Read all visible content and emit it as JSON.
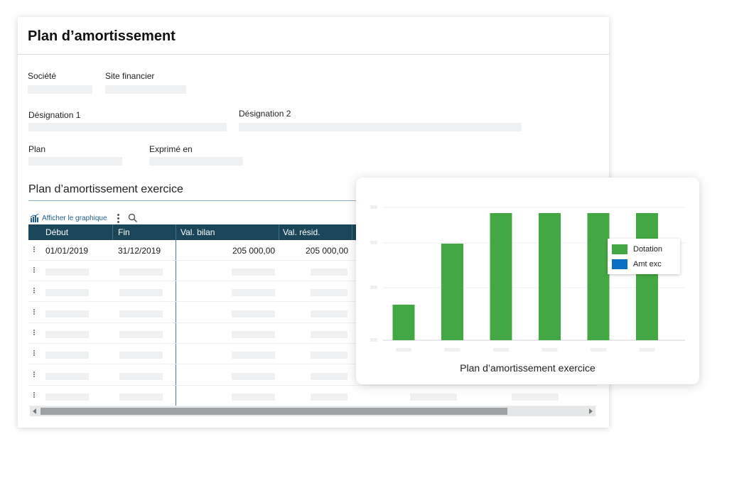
{
  "page": {
    "title": "Plan d’amortissement"
  },
  "fields": {
    "societe": "Société",
    "site_financier": "Site financier",
    "designation1": "Désignation 1",
    "designation2": "Désignation 2",
    "plan": "Plan",
    "exprime_en": "Exprimé en"
  },
  "section": {
    "title": "Plan d’amortissement exercice"
  },
  "toolbar": {
    "show_chart": "Afficher le graphique",
    "show_chart_icon": "chart-icon",
    "more_icon": "kebab-icon",
    "search_icon": "search-icon"
  },
  "table": {
    "headers": [
      "Début",
      "Fin",
      "Val. bilan",
      "Val. résid."
    ],
    "rows": [
      {
        "debut": "01/01/2019",
        "fin": "31/12/2019",
        "val_bilan": "205 000,00",
        "val_resid": "205 000,00"
      }
    ],
    "placeholder_rows": 7
  },
  "colors": {
    "header_bg": "#1b4659",
    "dotation": "#43a843",
    "amt_exc": "#0b6fc4",
    "placeholder": "#eef0f1"
  },
  "chart_data": {
    "type": "bar",
    "title": "Plan d’amortissement exercice",
    "categories": [
      "",
      "",
      "",
      "",
      "",
      ""
    ],
    "ylim": [
      0,
      100
    ],
    "grid": true,
    "legend_position": "right",
    "series": [
      {
        "name": "Dotation",
        "color": "#43a843",
        "values": [
          28,
          76,
          100,
          100,
          100,
          100
        ]
      },
      {
        "name": "Amt exc",
        "color": "#0b6fc4",
        "values": [
          0,
          0,
          0,
          0,
          0,
          0
        ]
      }
    ]
  }
}
